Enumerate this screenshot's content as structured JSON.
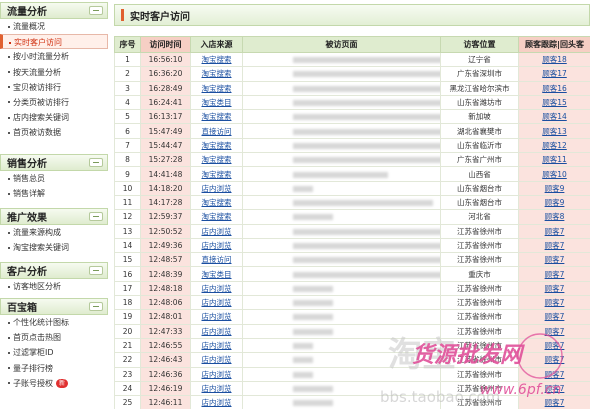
{
  "sidebar": {
    "sections": [
      {
        "title": "流量分析",
        "items": [
          "流量概况",
          "实时客户访问",
          "按小时流量分析",
          "按天流量分析",
          "宝贝被访排行",
          "分类页被访排行",
          "店内搜索关键词",
          "首页被访数据"
        ],
        "active": 1
      },
      {
        "title": "销售分析",
        "items": [
          "销售总员",
          "销售详解"
        ],
        "active": -1
      },
      {
        "title": "推广效果",
        "items": [
          "流量来源构成",
          "淘宝搜索关键词"
        ],
        "active": -1
      },
      {
        "title": "客户分析",
        "items": [
          "访客地区分析"
        ],
        "active": -1
      },
      {
        "title": "百宝箱",
        "items": [
          "个性化统计图标",
          "首页点击热图",
          "过滤掌柜ID",
          "量子排行榜",
          "子账号授权"
        ],
        "active": -1,
        "badge_item": 4,
        "badge": "新"
      }
    ]
  },
  "main": {
    "title": "实时客户访问",
    "headers": [
      "序号",
      "访问时间",
      "入店来源",
      "被访页面",
      "访客位置",
      "顾客跟踪|回头客"
    ],
    "rows": [
      [
        "1",
        "16:56:10",
        "淘宝搜索",
        "辽宁省",
        "顾客18"
      ],
      [
        "2",
        "16:36:20",
        "淘宝搜索",
        "广东省深圳市",
        "顾客17"
      ],
      [
        "3",
        "16:28:49",
        "淘宝搜索",
        "黑龙江省哈尔滨市",
        "顾客16"
      ],
      [
        "4",
        "16:24:41",
        "淘宝类目",
        "山东省潍坊市",
        "顾客15"
      ],
      [
        "5",
        "16:13:17",
        "淘宝搜索",
        "新加坡",
        "顾客14"
      ],
      [
        "6",
        "15:47:49",
        "直接访问",
        "湖北省襄樊市",
        "顾客13"
      ],
      [
        "7",
        "15:44:47",
        "淘宝搜索",
        "山东省临沂市",
        "顾客12"
      ],
      [
        "8",
        "15:27:28",
        "淘宝搜索",
        "广东省广州市",
        "顾客11"
      ],
      [
        "9",
        "14:41:48",
        "淘宝搜索",
        "山西省",
        "顾客10"
      ],
      [
        "10",
        "14:18:20",
        "店内浏览",
        "山东省烟台市",
        "顾客9"
      ],
      [
        "11",
        "14:17:28",
        "淘宝搜索",
        "山东省烟台市",
        "顾客9"
      ],
      [
        "12",
        "12:59:37",
        "淘宝搜索",
        "河北省",
        "顾客8"
      ],
      [
        "13",
        "12:50:52",
        "店内浏览",
        "江苏省徐州市",
        "顾客7"
      ],
      [
        "14",
        "12:49:36",
        "店内浏览",
        "江苏省徐州市",
        "顾客7"
      ],
      [
        "15",
        "12:48:57",
        "直接访问",
        "江苏省徐州市",
        "顾客7"
      ],
      [
        "16",
        "12:48:39",
        "淘宝类目",
        "重庆市",
        "顾客7"
      ],
      [
        "17",
        "12:48:18",
        "店内浏览",
        "江苏省徐州市",
        "顾客7"
      ],
      [
        "18",
        "12:48:06",
        "店内浏览",
        "江苏省徐州市",
        "顾客7"
      ],
      [
        "19",
        "12:48:01",
        "店内浏览",
        "江苏省徐州市",
        "顾客7"
      ],
      [
        "20",
        "12:47:33",
        "店内浏览",
        "江苏省徐州市",
        "顾客7"
      ],
      [
        "21",
        "12:46:55",
        "店内浏览",
        "江苏省徐州市",
        "顾客7"
      ],
      [
        "22",
        "12:46:43",
        "店内浏览",
        "江苏省徐州市",
        "顾客7"
      ],
      [
        "23",
        "12:46:36",
        "店内浏览",
        "江苏省徐州市",
        "顾客7"
      ],
      [
        "24",
        "12:46:19",
        "店内浏览",
        "江苏省徐州市",
        "顾客7"
      ],
      [
        "25",
        "12:46:11",
        "店内浏览",
        "江苏省徐州市",
        "顾客7"
      ]
    ],
    "blur_widths": [
      150,
      160,
      150,
      150,
      150,
      150,
      195,
      190,
      95,
      20,
      140,
      40,
      150,
      150,
      160,
      185,
      40,
      40,
      40,
      40,
      20,
      20,
      20,
      40,
      40
    ]
  },
  "watermark": {
    "brand": "淘宝",
    "text_1": "货源批发网",
    "text_2": "www.6pf.cn",
    "domain": "bbs.taobao.com"
  },
  "colors": {
    "accent": "#e06030",
    "header_green": "#dfeccf",
    "highlight": "#fbe3de",
    "link": "#1a4fa0",
    "watermark": "#e0509a"
  }
}
